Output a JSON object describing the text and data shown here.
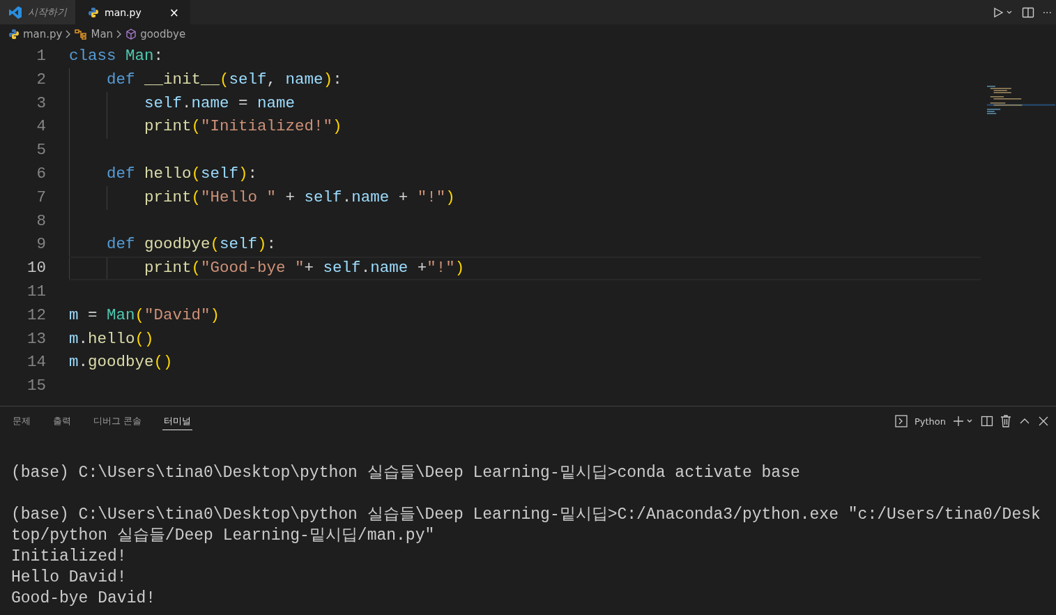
{
  "tabs": [
    {
      "label": "시작하기",
      "selected": false,
      "kind": "welcome",
      "preview": true
    },
    {
      "label": "man.py",
      "selected": true,
      "kind": "python",
      "preview": false,
      "close": "×"
    }
  ],
  "editor_actions": {
    "more": "···"
  },
  "breadcrumbs": [
    {
      "label": "man.py",
      "kind": "file"
    },
    {
      "label": "Man",
      "kind": "class"
    },
    {
      "label": "goodbye",
      "kind": "method"
    }
  ],
  "code": [
    {
      "number": "1",
      "current": false,
      "tokens": [
        {
          "text": "class ",
          "kind": "keyword"
        },
        {
          "text": "Man",
          "kind": "type"
        },
        {
          "text": ":",
          "kind": "punct"
        }
      ],
      "children": [
        {
          "number": "2",
          "current": false,
          "tokens": [
            {
              "text": "def ",
              "kind": "keyword"
            },
            {
              "text": "__init__",
              "kind": "function"
            },
            {
              "text": "(",
              "kind": "bracket"
            },
            {
              "text": "self",
              "kind": "variable"
            },
            {
              "text": ", ",
              "kind": "punct"
            },
            {
              "text": "name",
              "kind": "variable"
            },
            {
              "text": ")",
              "kind": "bracket"
            },
            {
              "text": ":",
              "kind": "punct"
            }
          ],
          "children": [
            {
              "number": "3",
              "current": false,
              "tokens": [
                {
                  "text": "self",
                  "kind": "variable"
                },
                {
                  "text": ".",
                  "kind": "punct"
                },
                {
                  "text": "name",
                  "kind": "variable"
                },
                {
                  "text": " = ",
                  "kind": "punct"
                },
                {
                  "text": "name",
                  "kind": "variable"
                }
              ]
            },
            {
              "number": "4",
              "current": false,
              "tokens": [
                {
                  "text": "print",
                  "kind": "function"
                },
                {
                  "text": "(",
                  "kind": "bracket"
                },
                {
                  "text": "\"Initialized!\"",
                  "kind": "string"
                },
                {
                  "text": ")",
                  "kind": "bracket"
                }
              ]
            }
          ]
        },
        {
          "number": "5",
          "current": false
        },
        {
          "number": "6",
          "current": false,
          "tokens": [
            {
              "text": "def ",
              "kind": "keyword"
            },
            {
              "text": "hello",
              "kind": "function"
            },
            {
              "text": "(",
              "kind": "bracket"
            },
            {
              "text": "self",
              "kind": "variable"
            },
            {
              "text": ")",
              "kind": "bracket"
            },
            {
              "text": ":",
              "kind": "punct"
            }
          ],
          "children": [
            {
              "number": "7",
              "current": false,
              "tokens": [
                {
                  "text": "print",
                  "kind": "function"
                },
                {
                  "text": "(",
                  "kind": "bracket"
                },
                {
                  "text": "\"Hello \"",
                  "kind": "string"
                },
                {
                  "text": " + ",
                  "kind": "punct"
                },
                {
                  "text": "self",
                  "kind": "variable"
                },
                {
                  "text": ".",
                  "kind": "punct"
                },
                {
                  "text": "name",
                  "kind": "variable"
                },
                {
                  "text": " + ",
                  "kind": "punct"
                },
                {
                  "text": "\"!\"",
                  "kind": "string"
                },
                {
                  "text": ")",
                  "kind": "bracket"
                }
              ]
            }
          ]
        },
        {
          "number": "8",
          "current": false
        },
        {
          "number": "9",
          "current": false,
          "tokens": [
            {
              "text": "def ",
              "kind": "keyword"
            },
            {
              "text": "goodbye",
              "kind": "function"
            },
            {
              "text": "(",
              "kind": "bracket"
            },
            {
              "text": "self",
              "kind": "variable"
            },
            {
              "text": ")",
              "kind": "bracket"
            },
            {
              "text": ":",
              "kind": "punct"
            }
          ],
          "children": [
            {
              "number": "10",
              "current": true,
              "tokens": [
                {
                  "text": "print",
                  "kind": "function"
                },
                {
                  "text": "(",
                  "kind": "bracket"
                },
                {
                  "text": "\"Good-bye \"",
                  "kind": "string"
                },
                {
                  "text": "+ ",
                  "kind": "punct"
                },
                {
                  "text": "self",
                  "kind": "variable"
                },
                {
                  "text": ".",
                  "kind": "punct"
                },
                {
                  "text": "name",
                  "kind": "variable"
                },
                {
                  "text": " +",
                  "kind": "punct"
                },
                {
                  "text": "\"!\"",
                  "kind": "string"
                },
                {
                  "text": ")",
                  "kind": "bracket"
                }
              ]
            }
          ]
        }
      ]
    },
    {
      "number": "11",
      "current": false
    },
    {
      "number": "12",
      "current": false,
      "tokens": [
        {
          "text": "m",
          "kind": "variable"
        },
        {
          "text": " = ",
          "kind": "punct"
        },
        {
          "text": "Man",
          "kind": "type"
        },
        {
          "text": "(",
          "kind": "bracket"
        },
        {
          "text": "\"David\"",
          "kind": "string"
        },
        {
          "text": ")",
          "kind": "bracket"
        }
      ]
    },
    {
      "number": "13",
      "current": false,
      "tokens": [
        {
          "text": "m",
          "kind": "variable"
        },
        {
          "text": ".",
          "kind": "punct"
        },
        {
          "text": "hello",
          "kind": "function"
        },
        {
          "text": "()",
          "kind": "bracket"
        }
      ]
    },
    {
      "number": "14",
      "current": false,
      "tokens": [
        {
          "text": "m",
          "kind": "variable"
        },
        {
          "text": ".",
          "kind": "punct"
        },
        {
          "text": "goodbye",
          "kind": "function"
        },
        {
          "text": "()",
          "kind": "bracket"
        }
      ]
    },
    {
      "number": "15",
      "current": false
    }
  ],
  "panel": {
    "tabs": [
      {
        "label": "문제",
        "selected": false
      },
      {
        "label": "출력",
        "selected": false
      },
      {
        "label": "디버그 콘솔",
        "selected": false
      },
      {
        "label": "터미널",
        "selected": true
      }
    ],
    "terminal_name": "Python"
  },
  "terminal": [
    {
      "kind": "prompt",
      "text": "(base) C:\\Users\\tina0\\Desktop\\python 실습들\\Deep Learning-밑시딥>conda activate base"
    },
    {
      "kind": "prompt",
      "text": "(base) C:\\Users\\tina0\\Desktop\\python 실습들\\Deep Learning-밑시딥>C:/Anaconda3/python.exe \"c:/Users/tina0/Desktop/python 실습들/Deep Learning-밑시딥/man.py\""
    },
    {
      "kind": "output",
      "text": "Initialized!"
    },
    {
      "kind": "output",
      "text": "Hello David!"
    },
    {
      "kind": "output",
      "text": "Good-bye David!"
    }
  ]
}
